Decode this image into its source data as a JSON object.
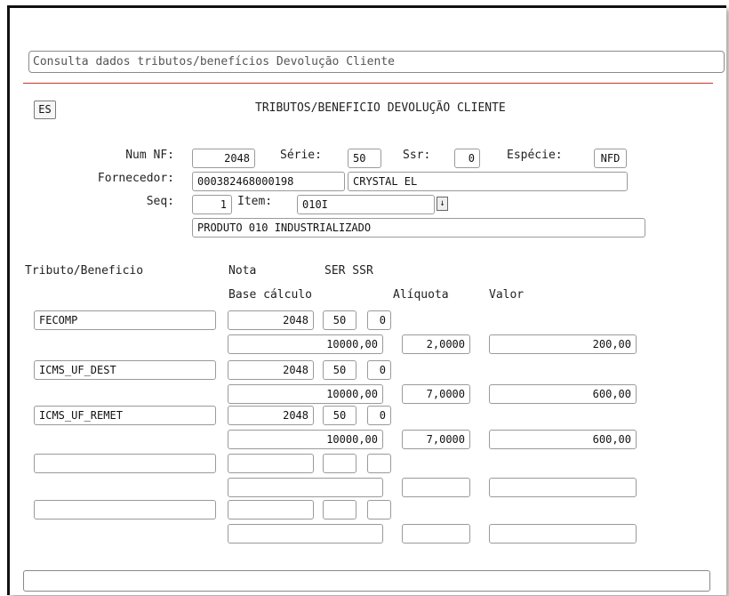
{
  "screen": {
    "title_field": "Consulta dados tributos/benefícios Devolução Cliente",
    "es_button": "ES",
    "heading": "TRIBUTOS/BENEFICIO DEVOLUÇÃO CLIENTE"
  },
  "header": {
    "num_nf_label": "Num NF:",
    "num_nf": "2048",
    "serie_label": "Série:",
    "serie": "50",
    "ssr_label": "Ssr:",
    "ssr": "0",
    "especie_label": "Espécie:",
    "especie": "NFD",
    "fornecedor_label": "Fornecedor:",
    "fornecedor_code": "000382468000198",
    "fornecedor_name": "CRYSTAL EL",
    "seq_label": "Seq:",
    "seq": "1",
    "item_label": "Item:",
    "item": "010I",
    "item_dropdown_icon": "↓",
    "produto": "PRODUTO 010 INDUSTRIALIZADO"
  },
  "columns": {
    "tributo": "Tributo/Beneficio",
    "nota": "Nota",
    "ser_ssr": "SER SSR",
    "base": "Base cálculo",
    "aliquota": "Alíquota",
    "valor": "Valor"
  },
  "rows": [
    {
      "tributo": "FECOMP",
      "nota": "2048",
      "ser": "50",
      "ssr": "0",
      "base": "10000,00",
      "aliquota": "2,0000",
      "valor": "200,00"
    },
    {
      "tributo": "ICMS_UF_DEST",
      "nota": "2048",
      "ser": "50",
      "ssr": "0",
      "base": "10000,00",
      "aliquota": "7,0000",
      "valor": "600,00"
    },
    {
      "tributo": "ICMS_UF_REMET",
      "nota": "2048",
      "ser": "50",
      "ssr": "0",
      "base": "10000,00",
      "aliquota": "7,0000",
      "valor": "600,00"
    },
    {
      "tributo": "",
      "nota": "",
      "ser": "",
      "ssr": "",
      "base": "",
      "aliquota": "",
      "valor": ""
    },
    {
      "tributo": "",
      "nota": "",
      "ser": "",
      "ssr": "",
      "base": "",
      "aliquota": "",
      "valor": ""
    }
  ],
  "status": ""
}
